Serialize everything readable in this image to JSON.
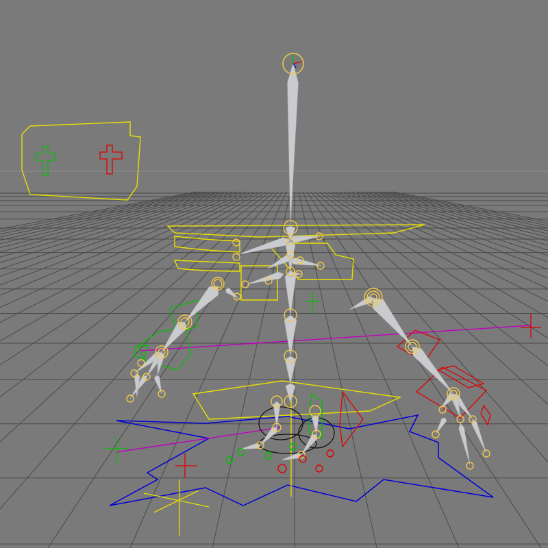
{
  "viewport": {
    "background": "#7a7a7a",
    "grid_color": "#4a4a4a",
    "horizon_color": "#8c8c8c"
  },
  "colors": {
    "control_yellow": "#e8e000",
    "control_green": "#00c000",
    "control_red": "#e00000",
    "control_blue": "#0000d8",
    "control_magenta": "#c000c0",
    "joint_ring": "#f2c94c",
    "bone_fill": "#c9cbce"
  },
  "icons": {
    "world_axis": "axis-gizmo-icon",
    "root_marker": "cross-locator-icon"
  }
}
